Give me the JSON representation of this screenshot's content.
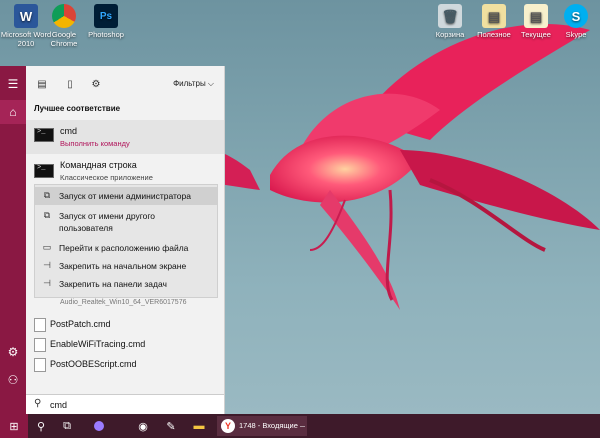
{
  "desktop_icons": [
    {
      "label": "Microsoft Word 2010",
      "glyph": "W",
      "color": "#2b579a"
    },
    {
      "label": "Google Chrome",
      "glyph": "",
      "color": "#ffffff"
    },
    {
      "label": "Photoshop",
      "glyph": "Ps",
      "color": "#001e36"
    },
    {
      "label": "Корзина",
      "glyph": "🗑",
      "color": "#cfd8dc"
    },
    {
      "label": "Полезное",
      "glyph": "▤",
      "color": "#f0e0a0"
    },
    {
      "label": "Текущее",
      "glyph": "▤",
      "color": "#f7f0cc"
    },
    {
      "label": "Skype",
      "glyph": "S",
      "color": "#00aff0"
    }
  ],
  "start_menu": {
    "filters_label": "Фильтры",
    "section_title": "Лучшее соответствие",
    "best_match": {
      "name": "cmd",
      "sub": "Выполнить команду",
      "sub_color": "#b0145a"
    },
    "second_match": {
      "name": "Командная строка",
      "sub": "Классическое приложение"
    },
    "context_menu": [
      {
        "icon": "⧉",
        "label": "Запуск от имени администратора"
      },
      {
        "icon": "⧉",
        "label": "Запуск от имени другого"
      },
      {
        "icon": "",
        "label": "пользователя"
      },
      {
        "icon": "▭",
        "label": "Перейти к расположению файла"
      },
      {
        "icon": "⊣",
        "label": "Закрепить на начальном экране"
      },
      {
        "icon": "⊣",
        "label": "Закрепить на панели задач"
      }
    ],
    "faded_item": "Audio_Realtek_Win10_64_VER6017576",
    "files": [
      "PostPatch.cmd",
      "EnableWiFiTracing.cmd",
      "PostOOBEScript.cmd"
    ],
    "search_value": "cmd"
  },
  "taskbar": {
    "yandex_label": "1748 - Входящие —..."
  },
  "colors": {
    "accent": "#8a1843",
    "taskbar": "#3e1a2a"
  }
}
